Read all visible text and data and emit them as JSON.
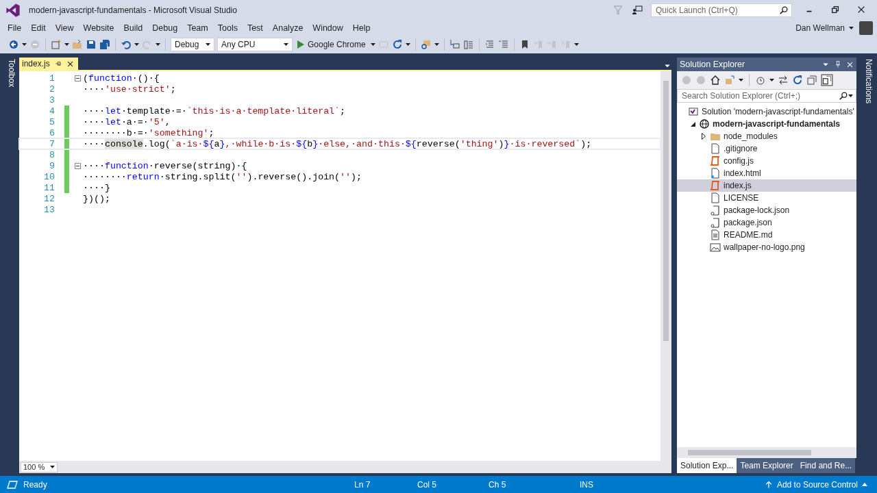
{
  "window": {
    "title": "modern-javascript-fundamentals - Microsoft Visual Studio"
  },
  "quick_launch": {
    "placeholder": "Quick Launch (Ctrl+Q)"
  },
  "menu": [
    "File",
    "Edit",
    "View",
    "Website",
    "Build",
    "Debug",
    "Team",
    "Tools",
    "Test",
    "Analyze",
    "Window",
    "Help"
  ],
  "user": "Dan Wellman",
  "toolbar": {
    "configuration": "Debug",
    "platform": "Any CPU",
    "run_target": "Google Chrome"
  },
  "side_tabs": {
    "left": "Toolbox",
    "right": "Notifications"
  },
  "editor": {
    "tabs": [
      {
        "label": "index.js",
        "selected": true
      }
    ],
    "lines": [
      {
        "number": "1",
        "fold": true,
        "changed": false,
        "current": false,
        "tokens": [
          {
            "kind": "plain",
            "text": "("
          },
          {
            "kind": "kw",
            "text": "function"
          },
          {
            "kind": "plain",
            "text": "·()·{"
          }
        ]
      },
      {
        "number": "2",
        "fold": false,
        "changed": false,
        "current": false,
        "tokens": [
          {
            "kind": "plain",
            "text": "····"
          },
          {
            "kind": "str",
            "text": "'use·strict'"
          },
          {
            "kind": "plain",
            "text": ";"
          }
        ]
      },
      {
        "number": "3",
        "fold": false,
        "changed": false,
        "current": false
      },
      {
        "number": "4",
        "fold": false,
        "changed": true,
        "current": false,
        "tokens": [
          {
            "kind": "plain",
            "text": "····"
          },
          {
            "kind": "kw",
            "text": "let"
          },
          {
            "kind": "plain",
            "text": "·template·=·"
          },
          {
            "kind": "str",
            "text": "`this·is·a·template·literal`"
          },
          {
            "kind": "plain",
            "text": ";"
          }
        ]
      },
      {
        "number": "5",
        "fold": false,
        "changed": true,
        "current": false,
        "tokens": [
          {
            "kind": "plain",
            "text": "····"
          },
          {
            "kind": "kw",
            "text": "let"
          },
          {
            "kind": "plain",
            "text": "·a·=·"
          },
          {
            "kind": "str",
            "text": "'5'"
          },
          {
            "kind": "plain",
            "text": ","
          }
        ]
      },
      {
        "number": "6",
        "fold": false,
        "changed": true,
        "current": false,
        "tokens": [
          {
            "kind": "plain",
            "text": "········b·=·"
          },
          {
            "kind": "str",
            "text": "'something'"
          },
          {
            "kind": "plain",
            "text": ";"
          }
        ]
      },
      {
        "number": "7",
        "fold": false,
        "changed": true,
        "current": true,
        "tokens": [
          {
            "kind": "plain",
            "text": "····"
          },
          {
            "kind": "hl",
            "text": "console"
          },
          {
            "kind": "plain",
            "text": ".log("
          },
          {
            "kind": "str",
            "text": "`a·is·"
          },
          {
            "kind": "kw",
            "text": "${"
          },
          {
            "kind": "plain",
            "text": "a"
          },
          {
            "kind": "kw",
            "text": "}"
          },
          {
            "kind": "str",
            "text": ",·while·b·is·"
          },
          {
            "kind": "kw",
            "text": "${"
          },
          {
            "kind": "plain",
            "text": "b"
          },
          {
            "kind": "kw",
            "text": "}"
          },
          {
            "kind": "str",
            "text": "·else,·and·this·"
          },
          {
            "kind": "kw",
            "text": "${"
          },
          {
            "kind": "plain",
            "text": "reverse("
          },
          {
            "kind": "str",
            "text": "'thing'"
          },
          {
            "kind": "plain",
            "text": ")"
          },
          {
            "kind": "kw",
            "text": "}"
          },
          {
            "kind": "str",
            "text": "·is·reversed`"
          },
          {
            "kind": "plain",
            "text": ");"
          }
        ]
      },
      {
        "number": "8",
        "fold": false,
        "changed": true,
        "current": false
      },
      {
        "number": "9",
        "fold": true,
        "changed": true,
        "current": false,
        "tokens": [
          {
            "kind": "plain",
            "text": "····"
          },
          {
            "kind": "kw",
            "text": "function"
          },
          {
            "kind": "plain",
            "text": "·reverse(string)·{"
          }
        ]
      },
      {
        "number": "10",
        "fold": false,
        "changed": true,
        "current": false,
        "tokens": [
          {
            "kind": "plain",
            "text": "········"
          },
          {
            "kind": "kw",
            "text": "return"
          },
          {
            "kind": "plain",
            "text": "·string.split("
          },
          {
            "kind": "str",
            "text": "''"
          },
          {
            "kind": "plain",
            "text": ").reverse().join("
          },
          {
            "kind": "str",
            "text": "''"
          },
          {
            "kind": "plain",
            "text": ");"
          }
        ]
      },
      {
        "number": "11",
        "fold": false,
        "changed": true,
        "current": false,
        "tokens": [
          {
            "kind": "plain",
            "text": "····}"
          }
        ]
      },
      {
        "number": "12",
        "fold": false,
        "changed": false,
        "current": false,
        "tokens": [
          {
            "kind": "plain",
            "text": "})();"
          }
        ]
      },
      {
        "number": "13",
        "fold": false,
        "changed": false,
        "current": false
      }
    ],
    "zoom": "100 %"
  },
  "solution_explorer": {
    "title": "Solution Explorer",
    "search": {
      "placeholder": "Search Solution Explorer (Ctrl+;)"
    },
    "tree": [
      {
        "label": "Solution 'modern-javascript-fundamentals'",
        "kind": "solution",
        "selected": false,
        "children": [
          {
            "label": "modern-javascript-fundamentals",
            "kind": "project",
            "selected": false,
            "expanded": true,
            "children": [
              {
                "label": "node_modules",
                "kind": "folder",
                "selected": false,
                "expanded": false
              },
              {
                "label": ".gitignore",
                "kind": "file",
                "selected": false
              },
              {
                "label": "config.js",
                "kind": "js",
                "selected": false
              },
              {
                "label": "index.html",
                "kind": "html",
                "selected": false
              },
              {
                "label": "index.js",
                "kind": "js",
                "selected": true
              },
              {
                "label": "LICENSE",
                "kind": "file",
                "selected": false
              },
              {
                "label": "package-lock.json",
                "kind": "json",
                "selected": false
              },
              {
                "label": "package.json",
                "kind": "json",
                "selected": false
              },
              {
                "label": "README.md",
                "kind": "text",
                "selected": false
              },
              {
                "label": "wallpaper-no-logo.png",
                "kind": "image",
                "selected": false
              }
            ]
          }
        ]
      }
    ]
  },
  "bottom_tabs": [
    {
      "label": "Solution Exp...",
      "selected": true
    },
    {
      "label": "Team Explorer",
      "selected": false
    },
    {
      "label": "Find and Re...",
      "selected": false
    }
  ],
  "status_bar": {
    "state": "Ready",
    "line": "Ln 7",
    "column": "Col 5",
    "char": "Ch 5",
    "mode": "INS",
    "source_control": "Add to Source Control"
  }
}
